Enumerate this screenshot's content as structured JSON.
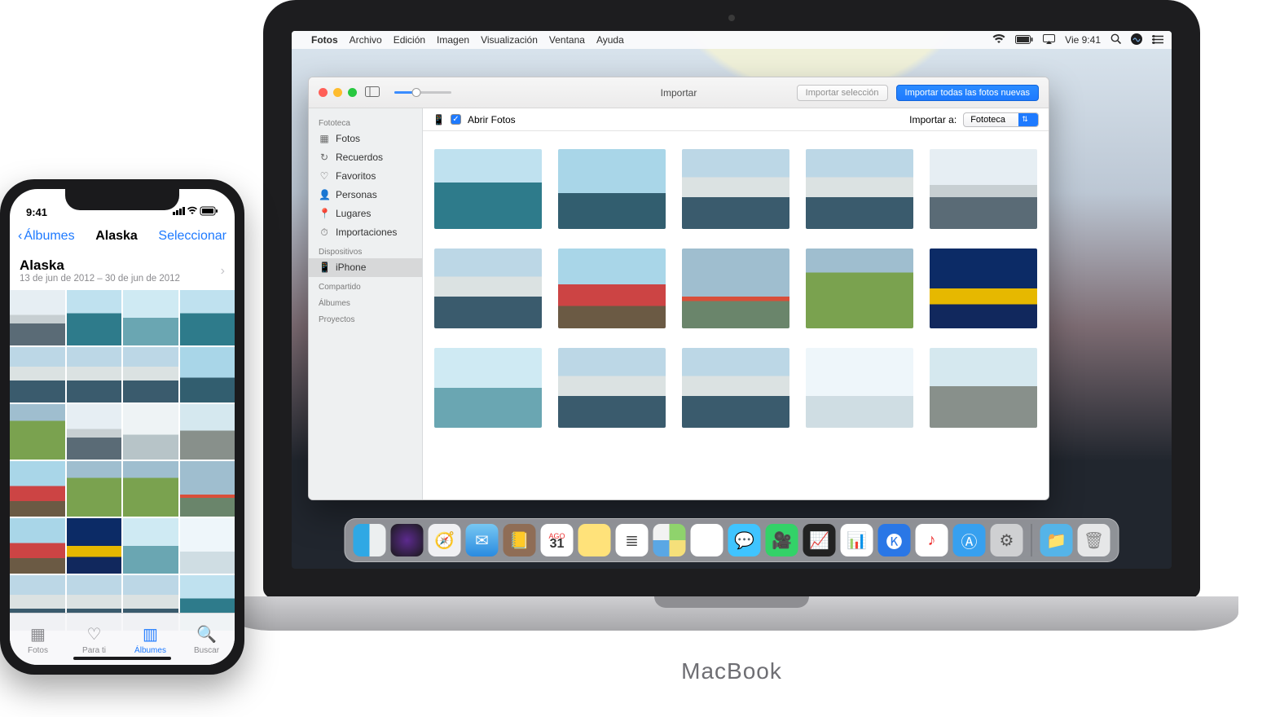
{
  "mac": {
    "brand": "MacBook",
    "menubar": {
      "apple": "",
      "app": "Fotos",
      "items": [
        "Archivo",
        "Edición",
        "Imagen",
        "Visualización",
        "Ventana",
        "Ayuda"
      ],
      "right": {
        "wifi": "􀙇",
        "battery": "■",
        "airplay": "▢",
        "clock": "Vie 9:41",
        "search": "🔍",
        "siri": "◉",
        "list": "☰"
      }
    },
    "window": {
      "title": "Importar",
      "btn_import_sel": "Importar selección",
      "btn_import_all": "Importar todas las fotos nuevas",
      "open_photos_label": "Abrir Fotos",
      "import_to_label": "Importar a:",
      "import_to_value": "Fototeca",
      "sidebar": {
        "s1_head": "Fototeca",
        "s1_items": [
          {
            "label": "Fotos",
            "icon": "▦"
          },
          {
            "label": "Recuerdos",
            "icon": "↻"
          },
          {
            "label": "Favoritos",
            "icon": "♡"
          },
          {
            "label": "Personas",
            "icon": "👤"
          },
          {
            "label": "Lugares",
            "icon": "📍"
          },
          {
            "label": "Importaciones",
            "icon": "⏱"
          }
        ],
        "s2_head": "Dispositivos",
        "s2_items": [
          {
            "label": "iPhone",
            "icon": "📱"
          }
        ],
        "s3_head": "Compartido",
        "s4_head": "Álbumes",
        "s5_head": "Proyectos"
      }
    },
    "dock": {
      "cal_month": "AGO",
      "cal_day": "31",
      "icons": [
        "finder",
        "siri",
        "safari",
        "mail",
        "contacts",
        "calendar",
        "notes",
        "reminders",
        "maps",
        "photos",
        "messages",
        "facetime",
        "stocks",
        "numbers",
        "keynote",
        "itunes",
        "appstore",
        "settings",
        "sep",
        "downloads",
        "trash"
      ]
    }
  },
  "iphone": {
    "status_time": "9:41",
    "nav": {
      "back": "Álbumes",
      "title": "Alaska",
      "action": "Seleccionar"
    },
    "album": {
      "title": "Alaska",
      "subtitle": "13 de jun de 2012 – 30 de jun de 2012"
    },
    "tabs": [
      {
        "label": "Fotos",
        "icon": "▦"
      },
      {
        "label": "Para ti",
        "icon": "♡"
      },
      {
        "label": "Álbumes",
        "icon": "▥"
      },
      {
        "label": "Buscar",
        "icon": "🔍"
      }
    ]
  }
}
